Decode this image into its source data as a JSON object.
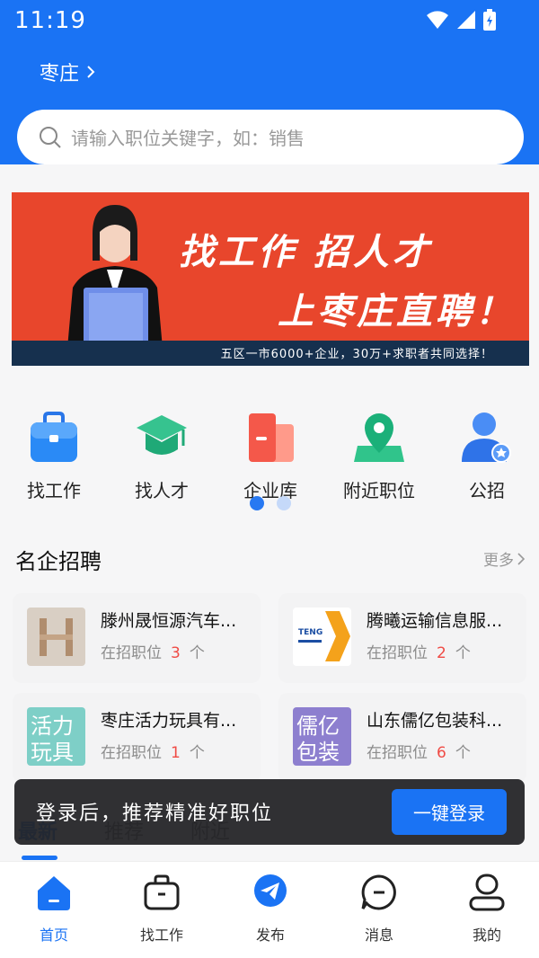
{
  "status_bar": {
    "time": "11:19"
  },
  "header": {
    "city": "枣庄",
    "search_placeholder": "请输入职位关键字，如：销售"
  },
  "banner": {
    "line1": "找工作  招人才",
    "line2": "上枣庄直聘！",
    "tagline": "五区一市6000+企业，30万+求职者共同选择！"
  },
  "quick_menu": [
    {
      "label": "找工作",
      "icon": "briefcase-icon"
    },
    {
      "label": "找人才",
      "icon": "graduation-cap-icon"
    },
    {
      "label": "企业库",
      "icon": "building-icon"
    },
    {
      "label": "附近职位",
      "icon": "map-pin-icon"
    },
    {
      "label": "公招",
      "icon": "person-badge-icon"
    }
  ],
  "carousel": {
    "pages": 2,
    "active": 1
  },
  "famous_companies": {
    "title": "名企招聘",
    "more": "更多",
    "count_label": "在招职位",
    "unit": "个",
    "items": [
      {
        "name": "滕州晟恒源汽车...",
        "count": "3",
        "logo": "H"
      },
      {
        "name": "腾曦运输信息服...",
        "count": "2",
        "logo": "TENGXI"
      },
      {
        "name": "枣庄活力玩具有...",
        "count": "1",
        "logo": "活力玩具"
      },
      {
        "name": "山东儒亿包装科...",
        "count": "6",
        "logo": "儒亿包装"
      }
    ]
  },
  "job_tabs": [
    "最新",
    "推荐",
    "附近"
  ],
  "toast": {
    "text": "登录后，推荐精准好职位",
    "button": "一键登录"
  },
  "bottom_nav": [
    {
      "label": "首页",
      "icon": "home-icon",
      "active": true
    },
    {
      "label": "找工作",
      "icon": "briefcase-icon",
      "active": false
    },
    {
      "label": "发布",
      "icon": "send-icon",
      "active": false
    },
    {
      "label": "消息",
      "icon": "message-icon",
      "active": false
    },
    {
      "label": "我的",
      "icon": "profile-icon",
      "active": false
    }
  ],
  "colors": {
    "primary": "#1a73f4",
    "banner_bg": "#e8462c",
    "count_red": "#f04b45"
  }
}
